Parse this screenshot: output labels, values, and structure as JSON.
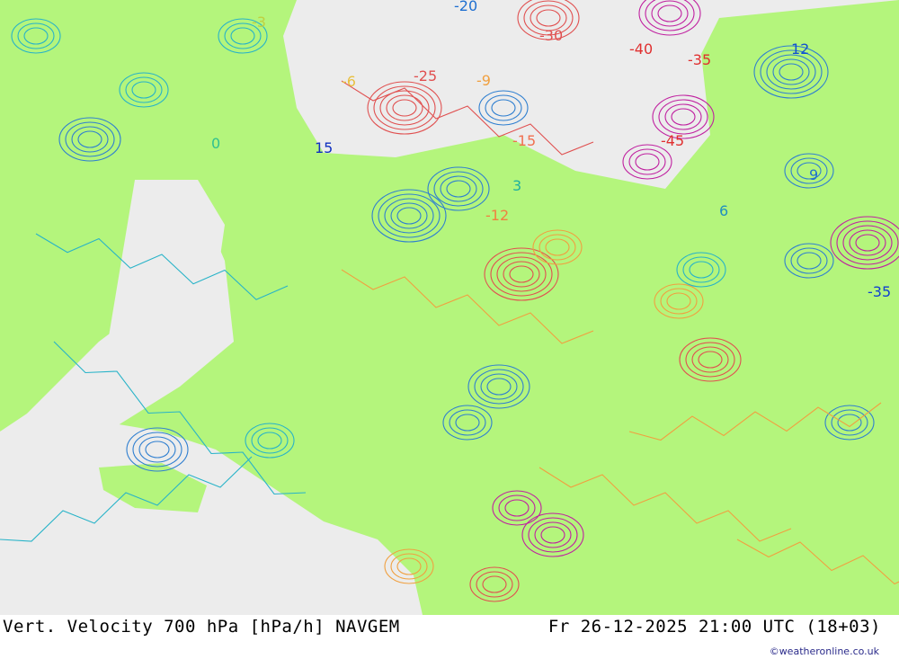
{
  "footer": {
    "title": "Vert. Velocity 700 hPa [hPa/h] NAVGEM",
    "valid_time": "Fr 26-12-2025 21:00 UTC (18+03)",
    "credit": "©weatheronline.co.uk"
  },
  "colors": {
    "land_positive": "#b4f57c",
    "sea": "#ececec",
    "blue_contour": "#2f7fd0",
    "cyan_contour": "#27b3c8",
    "orange_contour": "#f0a040",
    "red_contour": "#e05050",
    "magenta_contour": "#c020a0"
  },
  "contour_labels": [
    {
      "text": "-20",
      "color": "#1e6fd0"
    },
    {
      "text": "-30",
      "color": "#e05050"
    },
    {
      "text": "-40",
      "color": "#e03030"
    },
    {
      "text": "-35",
      "color": "#e03030"
    },
    {
      "text": "-45",
      "color": "#e03030"
    },
    {
      "text": "-25",
      "color": "#e05050"
    },
    {
      "text": "-15",
      "color": "#f07050"
    },
    {
      "text": "-9",
      "color": "#f0a040"
    },
    {
      "text": "-6",
      "color": "#e8c040"
    },
    {
      "text": "-3",
      "color": "#c0d040"
    },
    {
      "text": "-12",
      "color": "#f08040"
    },
    {
      "text": "3",
      "color": "#20b0a0"
    },
    {
      "text": "6",
      "color": "#2090c0"
    },
    {
      "text": "9",
      "color": "#2070d0"
    },
    {
      "text": "12",
      "color": "#1050d0"
    },
    {
      "text": "15",
      "color": "#1030c0"
    },
    {
      "text": "0",
      "color": "#30c090"
    },
    {
      "text": "-35",
      "color": "#1040d0"
    }
  ]
}
